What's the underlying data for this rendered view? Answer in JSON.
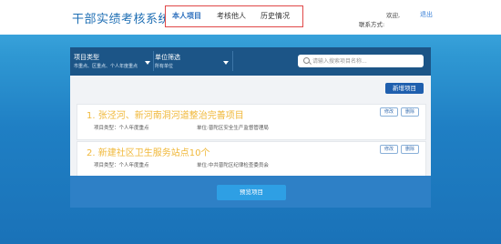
{
  "header": {
    "app_title": "干部实绩考核系统",
    "nav": [
      "本人项目",
      "考核他人",
      "历史情况"
    ],
    "active_nav": "本人项目",
    "greeting": "欢迎,",
    "contact": "联系方式:",
    "logout": "退出"
  },
  "filters": {
    "type": {
      "label": "项目类型",
      "value": "市重点、区重点、个人年度重点"
    },
    "unit": {
      "label": "单位筛选",
      "value": "所有单位"
    }
  },
  "search": {
    "placeholder": "请输入搜索项目名称...",
    "value": ""
  },
  "toolbar": {
    "add_label": "新增项目"
  },
  "projects": [
    {
      "title": "1. 张泾河、新河南洞河道整治完善项目",
      "type_text": "项目类型：个人年度重点",
      "unit_text": "单位:普陀区安全生产监督管理局",
      "edit_label": "修改",
      "delete_label": "删除"
    },
    {
      "title": "2. 新建社区卫生服务站点10个",
      "type_text": "项目类型：个人年度重点",
      "unit_text": "单位:中共普陀区纪律检查委员会",
      "edit_label": "修改",
      "delete_label": "删除"
    }
  ],
  "footer": {
    "preview_label": "预览项目"
  },
  "colors": {
    "brand": "#1f6fb4",
    "filterbar": "#1c5587",
    "title_accent": "#f0b83a",
    "nav_border": "#e04848"
  }
}
